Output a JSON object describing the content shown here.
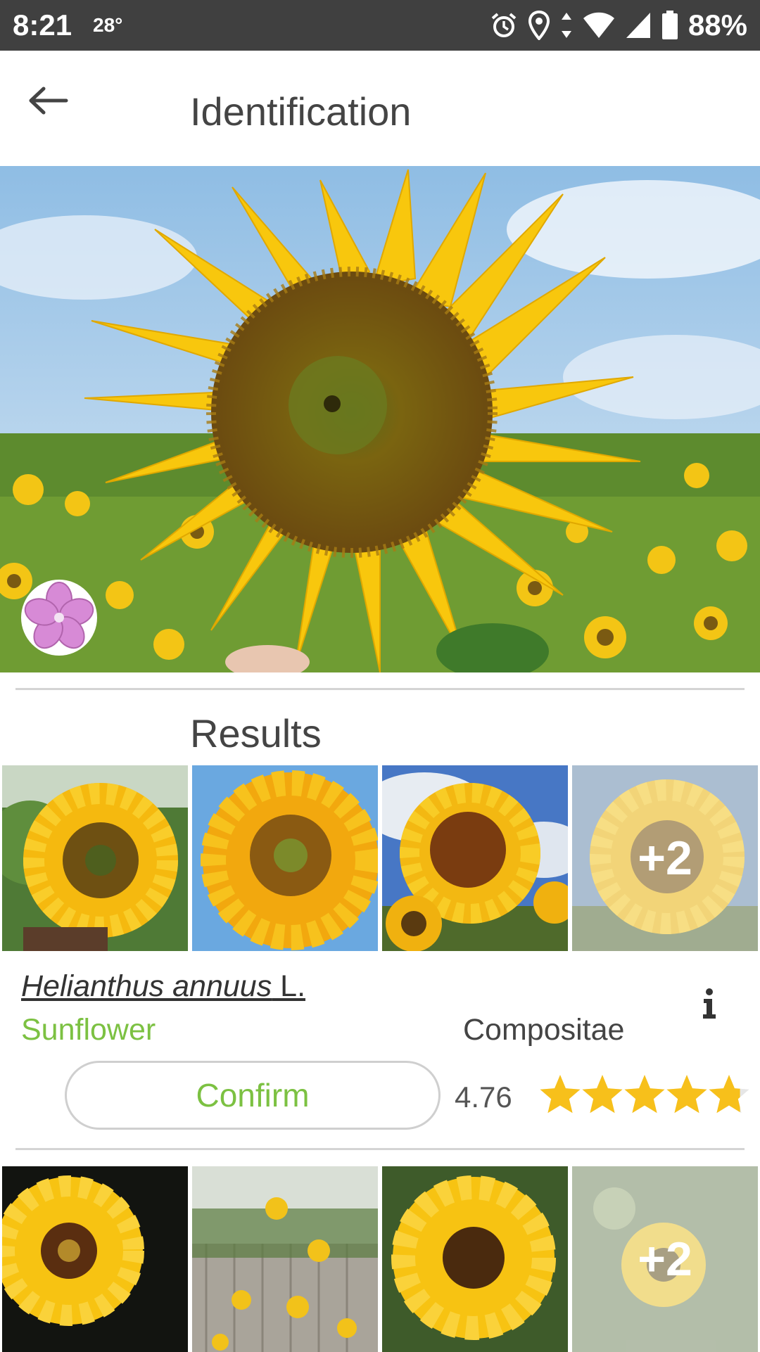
{
  "status_bar": {
    "time": "8:21",
    "temperature": "28°",
    "battery": "88%",
    "icons": [
      "alarm-icon",
      "location-icon",
      "data-arrows-icon",
      "wifi-icon",
      "signal-icon",
      "battery-icon"
    ]
  },
  "app_bar": {
    "back_icon": "arrow-left-icon",
    "title": "Identification"
  },
  "hero": {
    "subject": "sunflower",
    "organ_badge_icon": "flower-organ-icon"
  },
  "results": {
    "title": "Results",
    "items": [
      {
        "genus": "Helianthus annuus",
        "author": " L.",
        "common_name": "Sunflower",
        "family": "Compositae",
        "confirm_label": "Confirm",
        "score": "4.76",
        "rating": 4.76,
        "rating_max": 5,
        "more_count": "+2",
        "info_icon": "info-icon"
      }
    ],
    "second_row_more": "+2"
  },
  "colors": {
    "status_bar": "#404040",
    "accent_green": "#7cc142",
    "star_yellow": "#f7c01b",
    "divider": "#d4d4d4"
  }
}
